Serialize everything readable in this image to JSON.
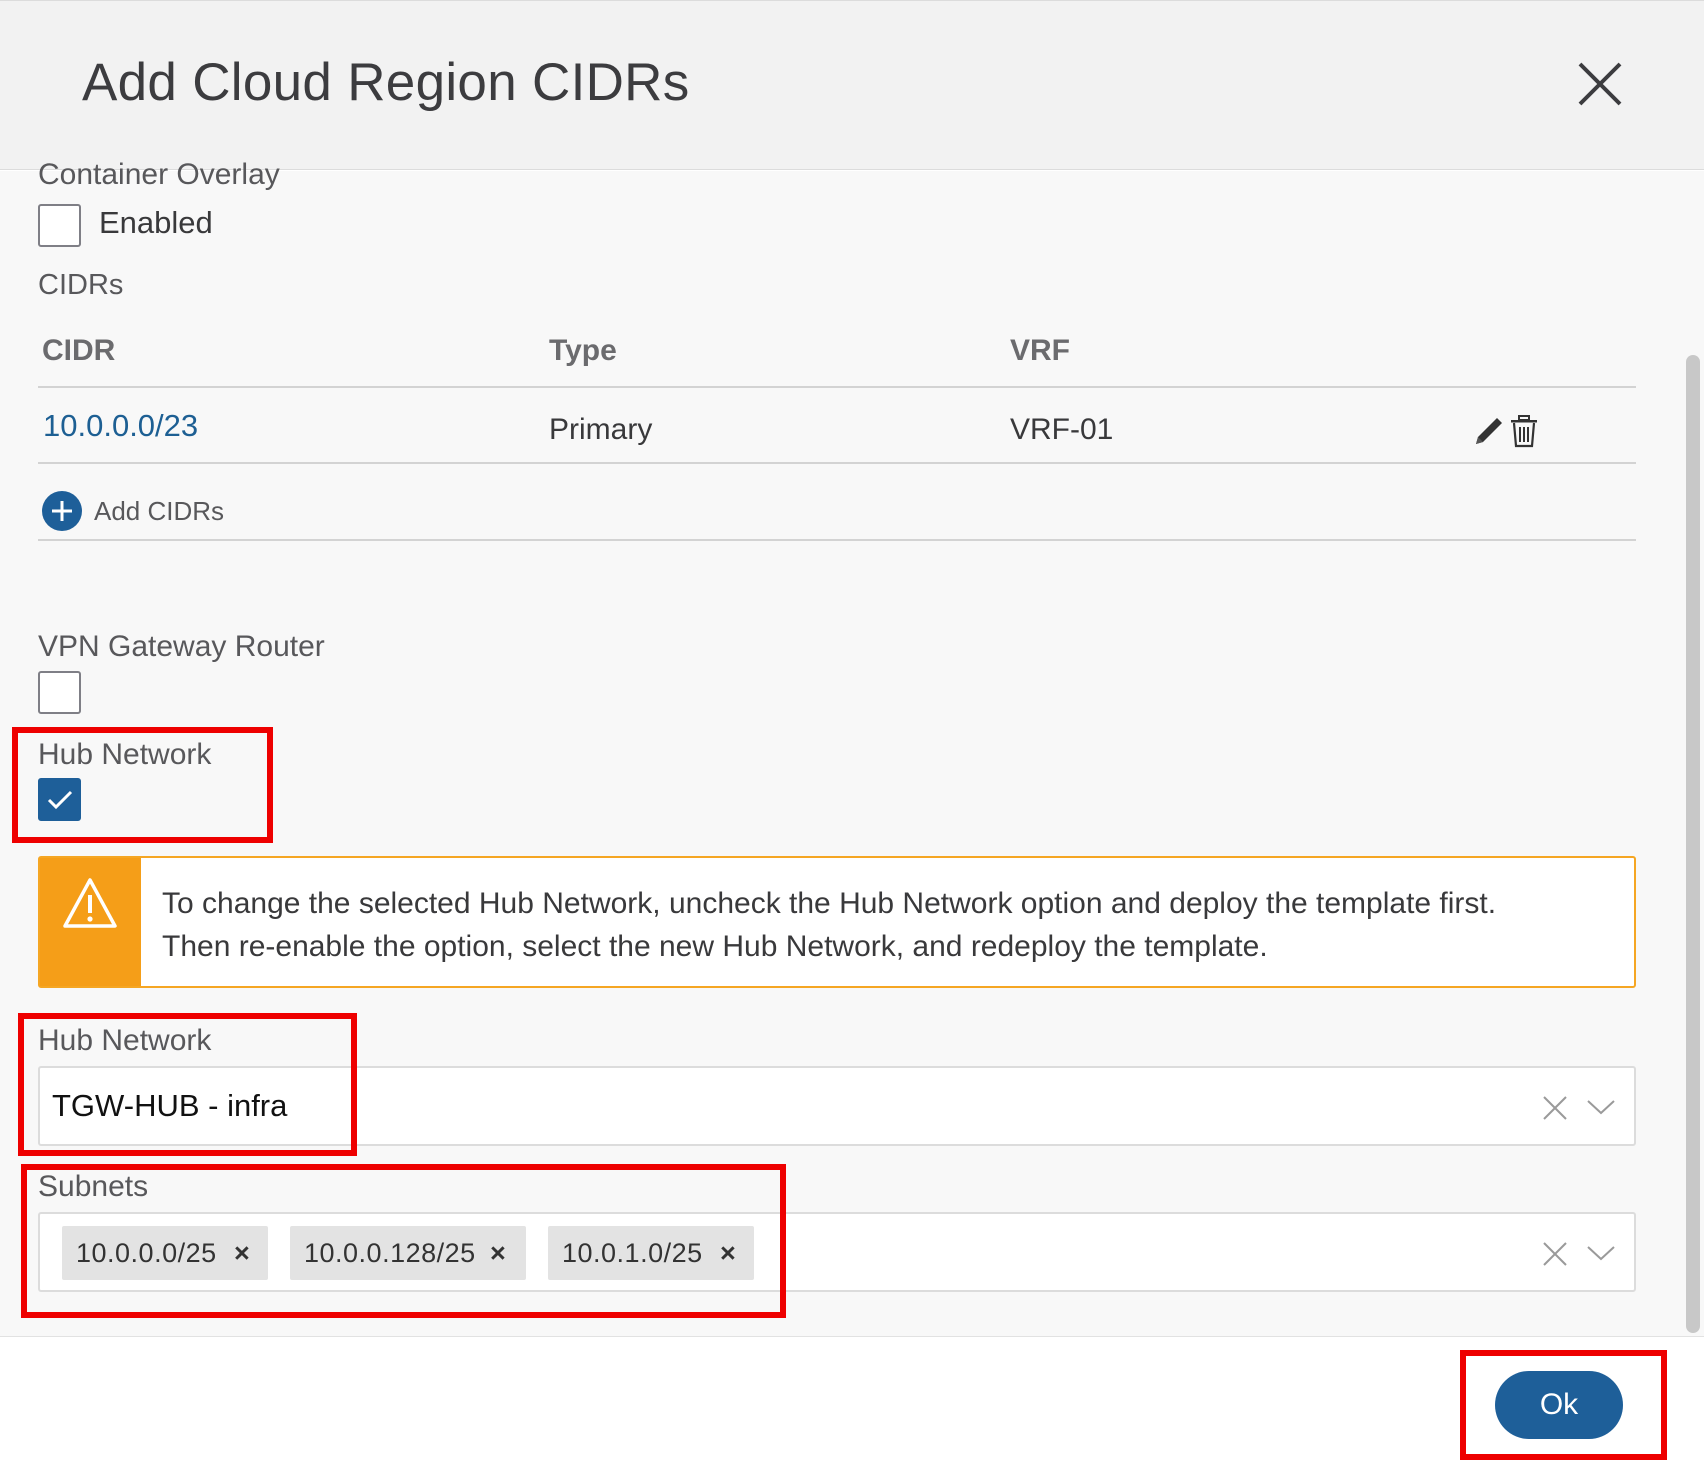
{
  "header": {
    "title": "Add Cloud Region CIDRs"
  },
  "container_overlay": {
    "label": "Container Overlay",
    "checkbox_label": "Enabled",
    "checked": false
  },
  "cidrs": {
    "section_label": "CIDRs",
    "columns": [
      "CIDR",
      "Type",
      "VRF"
    ],
    "rows": [
      {
        "cidr": "10.0.0.0/23",
        "type": "Primary",
        "vrf": "VRF-01"
      }
    ],
    "add_label": "Add CIDRs"
  },
  "vpn_gateway": {
    "label": "VPN Gateway Router",
    "checked": false
  },
  "hub_network_toggle": {
    "label": "Hub Network",
    "checked": true
  },
  "warning": {
    "line1": "To change the selected Hub Network, uncheck the Hub Network option and deploy the template first.",
    "line2": "Then re-enable the option, select the new Hub Network, and redeploy the template."
  },
  "hub_network_select": {
    "label": "Hub Network",
    "value": "TGW-HUB - infra"
  },
  "subnets": {
    "label": "Subnets",
    "chips": [
      "10.0.0.0/25",
      "10.0.0.128/25",
      "10.0.1.0/25"
    ]
  },
  "footer": {
    "ok_label": "Ok"
  },
  "colors": {
    "accent": "#1e5f99",
    "warning": "#f59e18",
    "annotation": "#ee0000"
  }
}
